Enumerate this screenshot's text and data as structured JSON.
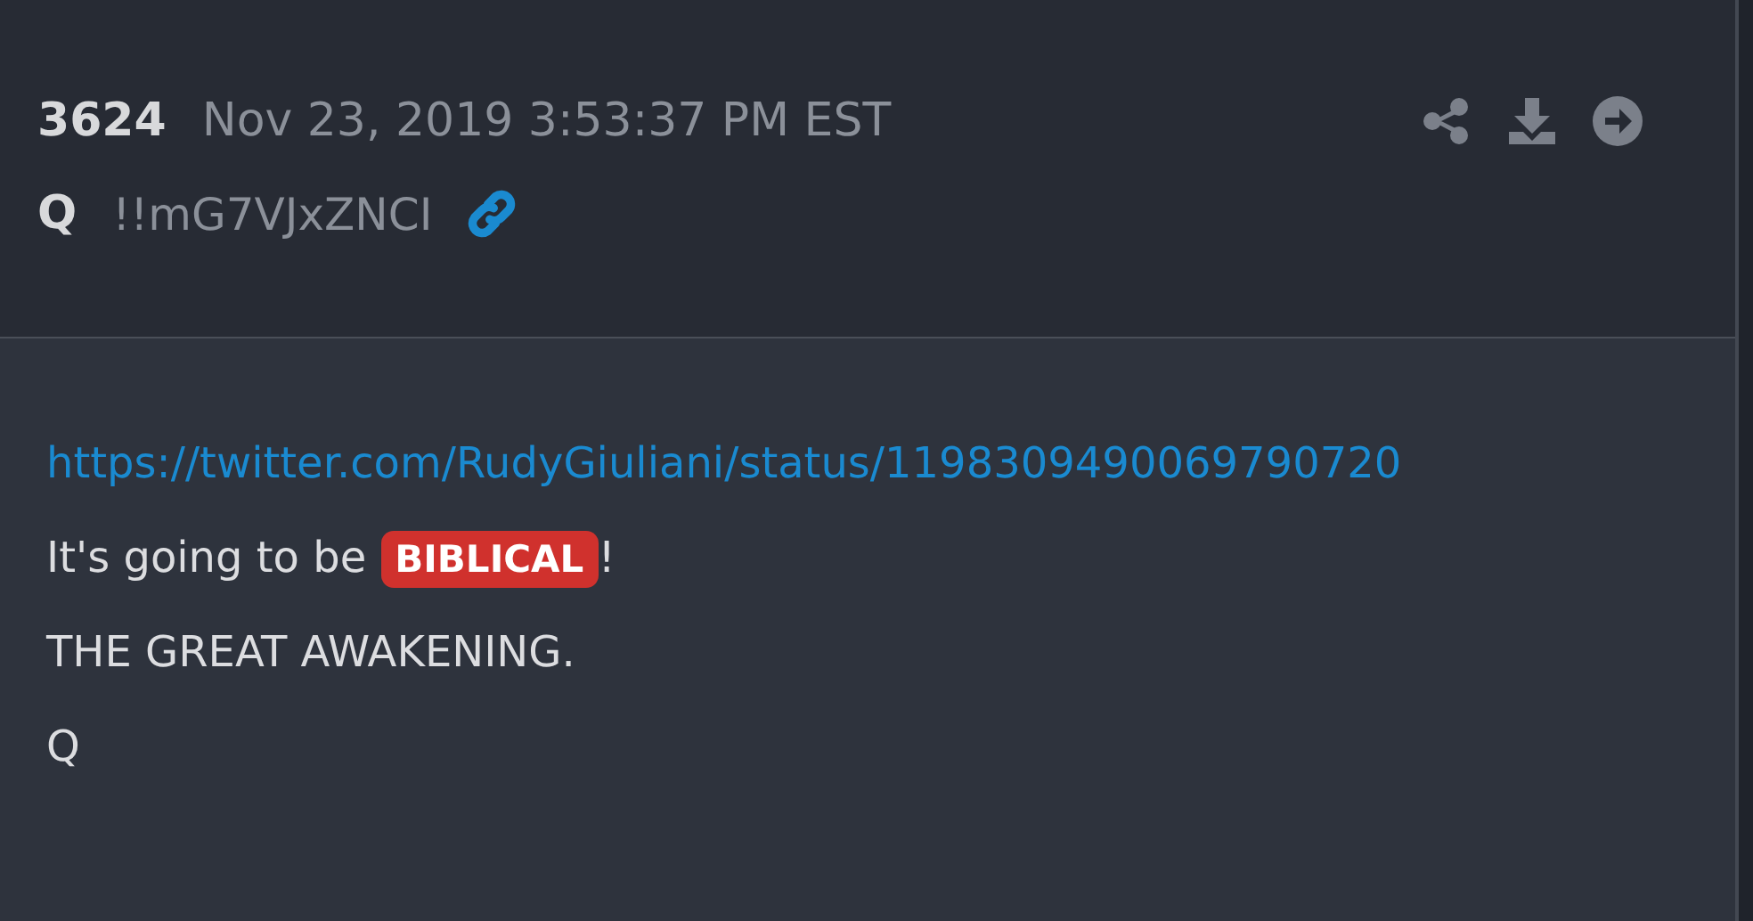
{
  "post": {
    "number": "3624",
    "timestamp": "Nov 23, 2019 3:53:37 PM EST",
    "author": "Q",
    "tripcode": "!!mG7VJxZNCI"
  },
  "body": [
    {
      "kind": "link",
      "text": "https://twitter.com/RudyGiuliani/status/1198309490069790720"
    },
    {
      "kind": "tagged",
      "before": "It's going to be",
      "tag": "BIBLICAL",
      "after": "!"
    },
    {
      "kind": "text",
      "text": "THE GREAT AWAKENING."
    },
    {
      "kind": "text",
      "text": "Q"
    }
  ]
}
